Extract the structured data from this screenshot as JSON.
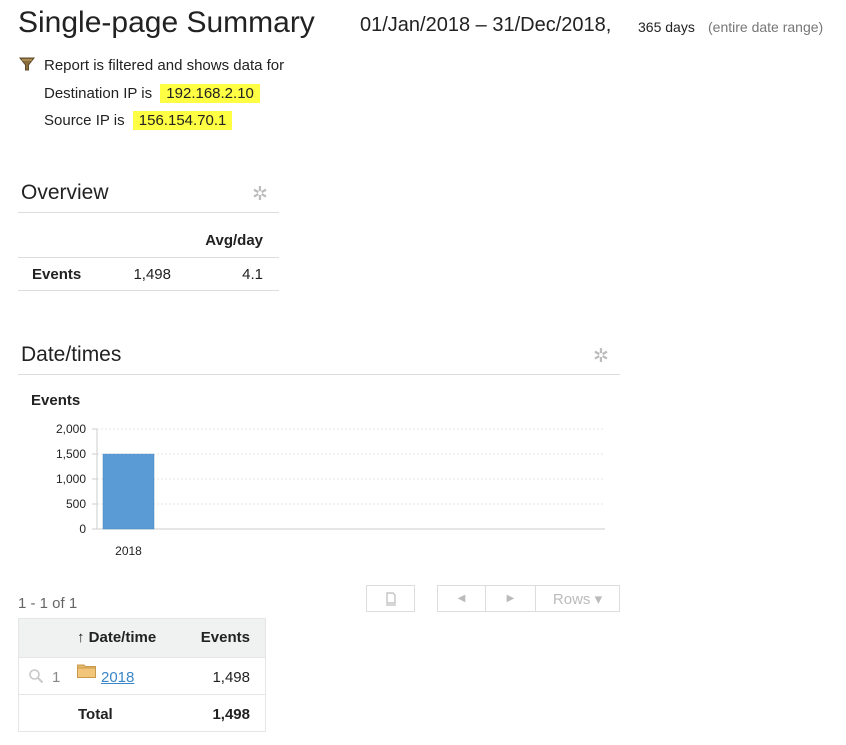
{
  "header": {
    "title": "Single-page Summary",
    "date_range": "01/Jan/2018 – 31/Dec/2018,",
    "days": "365 days",
    "entire_range": "(entire date range)"
  },
  "filter": {
    "intro": "Report is filtered and shows data for",
    "destination_label": "Destination IP is",
    "destination_value": "192.168.2.10",
    "source_label": "Source IP is",
    "source_value": "156.154.70.1"
  },
  "overview": {
    "title": "Overview",
    "col_avg": "Avg/day",
    "row_label": "Events",
    "row_total": "1,498",
    "row_avg": "4.1"
  },
  "datetimes": {
    "title": "Date/times",
    "pagination": "1 - 1 of 1",
    "rows_button": "Rows ▾",
    "prev_icon": "◀",
    "next_icon": "▶",
    "table": {
      "col_date": "↑ Date/time",
      "col_events": "Events",
      "rows": [
        {
          "index": "1",
          "date": "2018",
          "events": "1,498"
        }
      ],
      "total_label": "Total",
      "total_value": "1,498"
    }
  },
  "chart_data": {
    "type": "bar",
    "ylabel": "Events",
    "categories": [
      "2018"
    ],
    "values": [
      1498
    ],
    "ylim": [
      0,
      2000
    ],
    "yticks": [
      "0",
      "500",
      "1,000",
      "1,500",
      "2,000"
    ],
    "grid": true,
    "bar_color": "#5b9bd5"
  },
  "icons": {
    "filter": "filter-icon",
    "gear": "gear-icon",
    "folder": "folder-icon",
    "magnifier": "search-icon"
  }
}
